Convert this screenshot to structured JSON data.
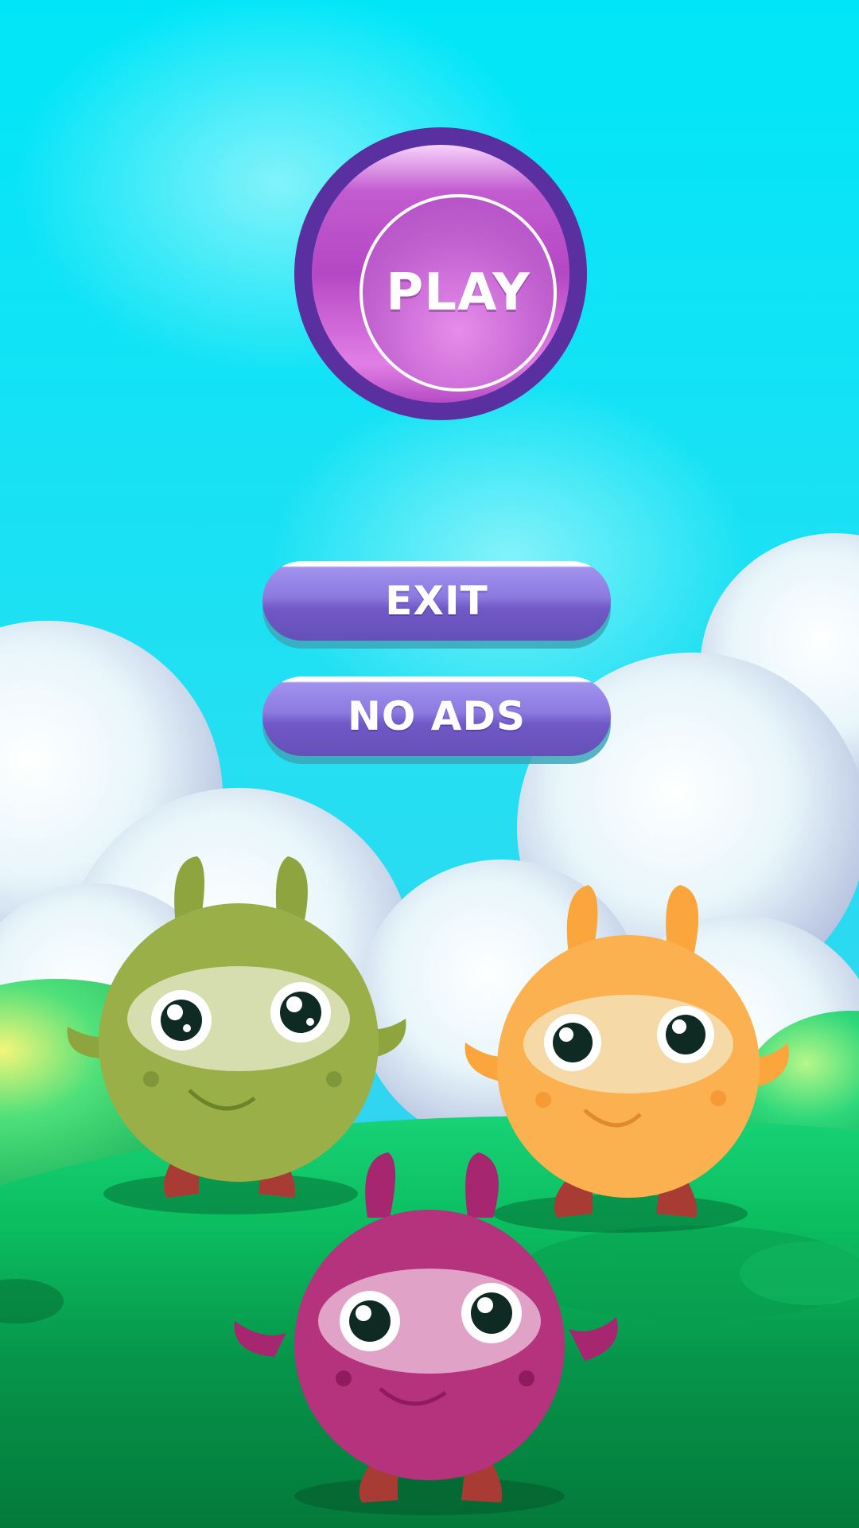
{
  "menu": {
    "play_label": "PLAY",
    "exit_label": "EXIT",
    "no_ads_label": "NO ADS"
  },
  "colors": {
    "sky": "#00e6f5",
    "play_outer": "#5a2fa0",
    "play_face": "#c25bd0",
    "pill_button": "#7a62d2",
    "grass": "#07883f"
  },
  "characters": [
    {
      "name": "green-monster",
      "color": "#9aaf48"
    },
    {
      "name": "orange-monster",
      "color": "#fbb14f"
    },
    {
      "name": "magenta-monster",
      "color": "#b5327c"
    }
  ]
}
